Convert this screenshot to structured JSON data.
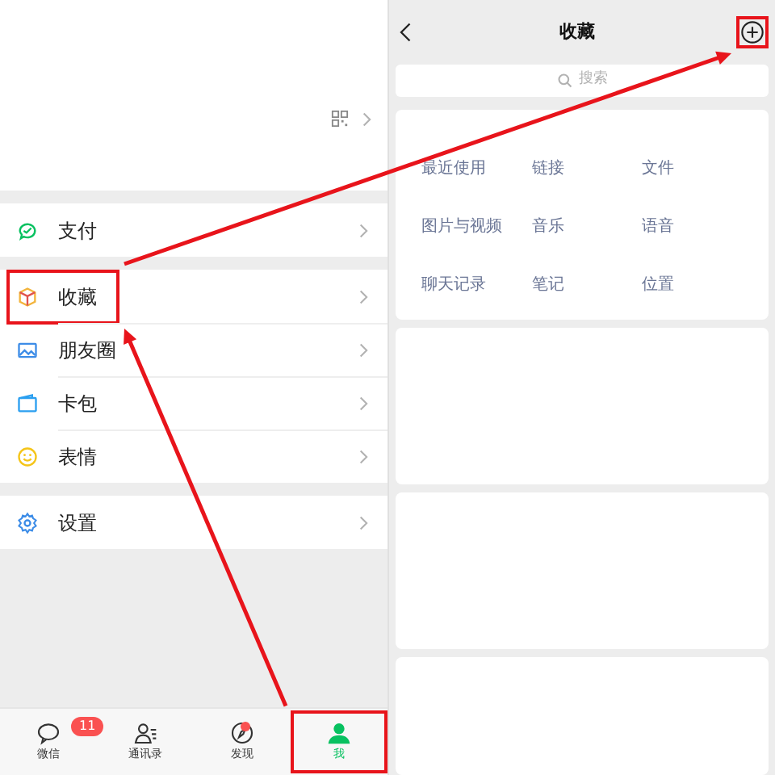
{
  "left": {
    "menu_groups": [
      [
        {
          "label": "支付",
          "kind": "pay",
          "highlighted": false
        }
      ],
      [
        {
          "label": "收藏",
          "kind": "favorites",
          "highlighted": true
        },
        {
          "label": "朋友圈",
          "kind": "moments",
          "highlighted": false
        },
        {
          "label": "卡包",
          "kind": "cards",
          "highlighted": false
        },
        {
          "label": "表情",
          "kind": "stickers",
          "highlighted": false
        }
      ],
      [
        {
          "label": "设置",
          "kind": "settings",
          "highlighted": false
        }
      ]
    ],
    "tab_bar": [
      {
        "label": "微信",
        "kind": "chat",
        "badge": "11",
        "dot": false,
        "selected": false,
        "highlighted": false
      },
      {
        "label": "通讯录",
        "kind": "contacts",
        "dot": false,
        "selected": false,
        "highlighted": false
      },
      {
        "label": "发现",
        "kind": "discover",
        "dot": true,
        "selected": false,
        "highlighted": false
      },
      {
        "label": "我",
        "kind": "me",
        "dot": false,
        "selected": true,
        "highlighted": true
      }
    ]
  },
  "right": {
    "title": "收藏",
    "add_highlighted": true,
    "search": {
      "placeholder": "搜索"
    },
    "categories": [
      "最近使用",
      "链接",
      "文件",
      "图片与视频",
      "音乐",
      "语音",
      "聊天记录",
      "笔记",
      "位置"
    ]
  },
  "arrows_between_highlights": true
}
